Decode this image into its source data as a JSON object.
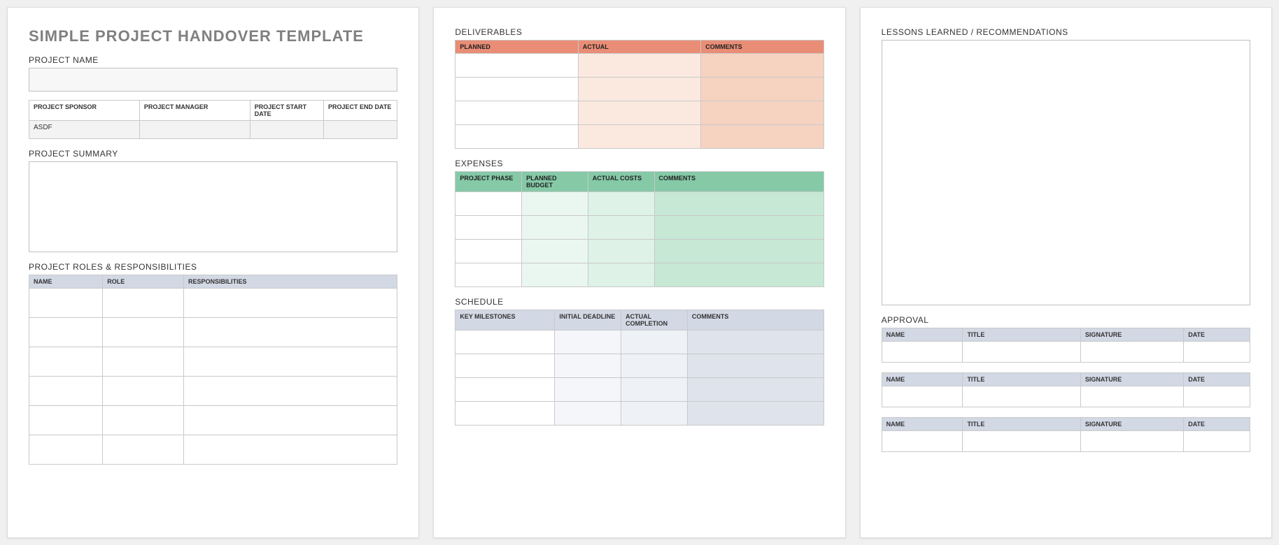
{
  "title": "SIMPLE PROJECT HANDOVER TEMPLATE",
  "page1": {
    "project_name_label": "PROJECT NAME",
    "meta": {
      "headers": [
        "PROJECT SPONSOR",
        "PROJECT MANAGER",
        "PROJECT START DATE",
        "PROJECT END DATE"
      ],
      "values": [
        "ASDF",
        "",
        "",
        ""
      ]
    },
    "summary_label": "PROJECT SUMMARY",
    "roles_label": "PROJECT ROLES & RESPONSIBILITIES",
    "roles_headers": [
      "NAME",
      "ROLE",
      "RESPONSIBILITIES"
    ]
  },
  "page2": {
    "deliverables_label": "DELIVERABLES",
    "deliverables_headers": [
      "PLANNED",
      "ACTUAL",
      "COMMENTS"
    ],
    "expenses_label": "EXPENSES",
    "expenses_headers": [
      "PROJECT PHASE",
      "PLANNED BUDGET",
      "ACTUAL COSTS",
      "COMMENTS"
    ],
    "schedule_label": "SCHEDULE",
    "schedule_headers": [
      "KEY MILESTONES",
      "INITIAL DEADLINE",
      "ACTUAL COMPLETION",
      "COMMENTS"
    ]
  },
  "page3": {
    "lessons_label": "LESSONS LEARNED / RECOMMENDATIONS",
    "approval_label": "APPROVAL",
    "approval_headers": [
      "NAME",
      "TITLE",
      "SIGNATURE",
      "DATE"
    ]
  }
}
